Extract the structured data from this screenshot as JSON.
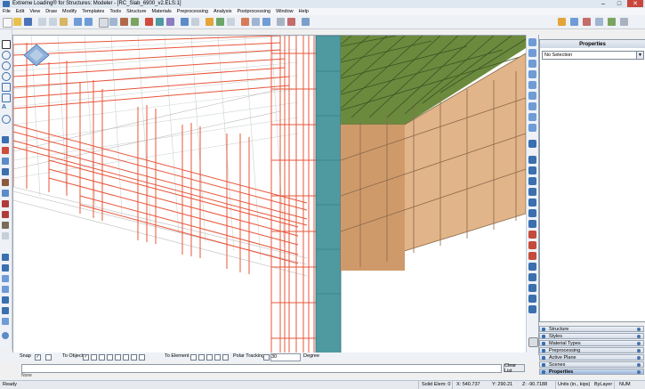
{
  "window": {
    "title": "Extreme Loading® for Structures: Modeler - [RC_Slab_6900_v2.ELS:1]",
    "minimize": "–",
    "maximize": "□",
    "close": "✕"
  },
  "menu": [
    "File",
    "Edit",
    "View",
    "Draw",
    "Modify",
    "Templates",
    "Tools",
    "Structure",
    "Materials",
    "Preprocessing",
    "Analysis",
    "Postprocessing",
    "Window",
    "Help"
  ],
  "properties": {
    "title": "Properties",
    "selection": "No Selection"
  },
  "panels": [
    {
      "label": "Structure"
    },
    {
      "label": "Styles"
    },
    {
      "label": "Material Types"
    },
    {
      "label": "Preprocessing"
    },
    {
      "label": "Active Plane"
    },
    {
      "label": "Scenes"
    },
    {
      "label": "Properties",
      "active": true
    }
  ],
  "snap": {
    "snap_label": "Snap",
    "to_object_label": "To Object",
    "to_element_label": "To Element",
    "polar_label": "Polar Tracking",
    "polar_value": "30",
    "degree_label": "Degree"
  },
  "command": {
    "clear_label": "Clear List",
    "history": "None"
  },
  "status": {
    "ready": "Ready",
    "solid_elem": "Solid Elem: 0",
    "x": "X: 540.737",
    "y": "Y: 290.21",
    "z": "Z: -90.7188",
    "units": "Units (in., kips)",
    "layer": "ByLayer",
    "num": "NUM"
  },
  "colors": {
    "accent": "#3a6fb0",
    "rebar": "#e8553a",
    "brick": "#e2b48a",
    "slab_top": "#6b8a3e",
    "column": "#4f9aa1"
  }
}
